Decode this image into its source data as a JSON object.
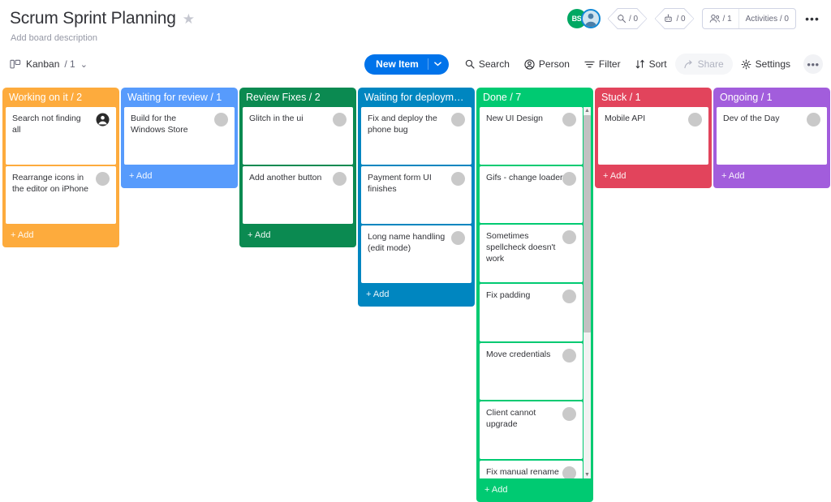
{
  "header": {
    "board_title": "Scrum Sprint Planning",
    "star_icon": "star-icon",
    "board_description": "Add board description",
    "avatars": [
      {
        "type": "initials",
        "label": "BS",
        "color": "#00a862"
      },
      {
        "type": "photo",
        "label": "",
        "color": "#0f88d6"
      }
    ],
    "badges": [
      {
        "icon": "bug-search-icon",
        "value": "/ 0"
      },
      {
        "icon": "robot-icon",
        "value": "/ 0"
      }
    ],
    "people_pill": {
      "people_icon": "people-icon",
      "people_count": "/ 1",
      "activities_label": "Activities / 0"
    },
    "more_menu": "•••"
  },
  "toolbar": {
    "view_icon": "kanban-board-icon",
    "view_label": "Kanban",
    "view_count": "/ 1",
    "view_chevron": "⌄",
    "new_item_label": "New Item",
    "new_item_chevron": "⌄",
    "buttons": [
      {
        "name": "search",
        "icon": "search-icon",
        "label": "Search",
        "disabled": false
      },
      {
        "name": "person",
        "icon": "person-circle-icon",
        "label": "Person",
        "disabled": false
      },
      {
        "name": "filter",
        "icon": "filter-icon",
        "label": "Filter",
        "disabled": false
      },
      {
        "name": "sort",
        "icon": "sort-icon",
        "label": "Sort",
        "disabled": false
      },
      {
        "name": "share",
        "icon": "share-icon",
        "label": "Share",
        "disabled": true
      },
      {
        "name": "settings",
        "icon": "gear-icon",
        "label": "Settings",
        "disabled": false
      }
    ],
    "more_label": "•••"
  },
  "board": {
    "add_label": "+ Add",
    "columns": [
      {
        "title": "Working on it / 2",
        "color": "#fdab3d",
        "truncated": false,
        "scrollable": false,
        "cards": [
          {
            "text": "Search not finding all",
            "avatar": "person-avatar"
          },
          {
            "text": "Rearrange icons in the editor on iPhone",
            "avatar": "empty-avatar"
          }
        ]
      },
      {
        "title": "Waiting for review / 1",
        "color": "#579bfc",
        "truncated": false,
        "scrollable": false,
        "cards": [
          {
            "text": "Build for the Windows Store",
            "avatar": "empty-avatar"
          }
        ]
      },
      {
        "title": "Review Fixes / 2",
        "color": "#0b8a51",
        "truncated": false,
        "scrollable": false,
        "cards": [
          {
            "text": "Glitch in the ui",
            "avatar": "empty-avatar"
          },
          {
            "text": "Add another button",
            "avatar": "empty-avatar"
          }
        ]
      },
      {
        "title": "Waiting for deployment /…",
        "color": "#0086c0",
        "truncated": true,
        "scrollable": false,
        "cards": [
          {
            "text": "Fix and deploy the phone bug",
            "avatar": "empty-avatar"
          },
          {
            "text": "Payment form UI finishes",
            "avatar": "empty-avatar"
          },
          {
            "text": "Long name handling (edit mode)",
            "avatar": "empty-avatar"
          }
        ]
      },
      {
        "title": "Done / 7",
        "color": "#00ca72",
        "truncated": false,
        "scrollable": true,
        "cards": [
          {
            "text": "New UI Design",
            "avatar": "empty-avatar"
          },
          {
            "text": "Gifs - change loader",
            "avatar": "empty-avatar"
          },
          {
            "text": "Sometimes spellcheck doesn't work",
            "avatar": "empty-avatar"
          },
          {
            "text": "Fix padding",
            "avatar": "empty-avatar"
          },
          {
            "text": "Move credentials",
            "avatar": "empty-avatar"
          },
          {
            "text": "Client cannot upgrade",
            "avatar": "empty-avatar"
          },
          {
            "text": "Fix manual rename",
            "avatar": "empty-avatar",
            "clipped": true
          }
        ]
      },
      {
        "title": "Stuck / 1",
        "color": "#e2445c",
        "truncated": false,
        "scrollable": false,
        "cards": [
          {
            "text": "Mobile API",
            "avatar": "empty-avatar"
          }
        ]
      },
      {
        "title": "Ongoing / 1",
        "color": "#a25ddc",
        "truncated": false,
        "scrollable": false,
        "cards": [
          {
            "text": "Dev of the Day",
            "avatar": "empty-avatar"
          }
        ]
      }
    ]
  }
}
